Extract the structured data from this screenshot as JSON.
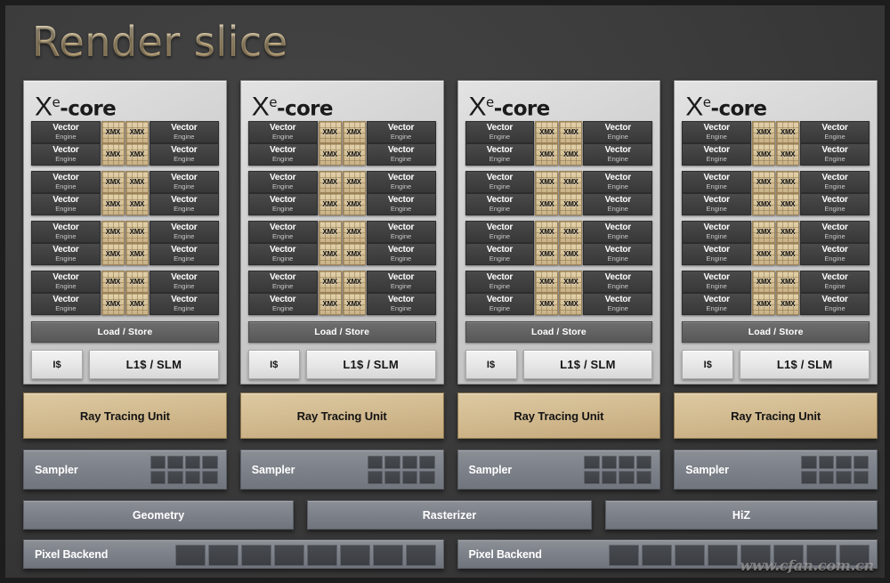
{
  "title": "Render slice",
  "core": {
    "title_x": "X",
    "title_sup": "e",
    "title_rest": "-core",
    "vector_label_1": "Vector",
    "vector_label_2": "Engine",
    "xmx_label": "XMX",
    "load_store_label": "Load / Store",
    "instruction_cache_label": "I$",
    "l1_slm_label": "L1$ / SLM",
    "groups_per_core": 4,
    "rows_per_group": 2,
    "count": 4
  },
  "ray_tracing": {
    "label": "Ray Tracing Unit",
    "count": 4,
    "color": "#d2ba90"
  },
  "sampler": {
    "label": "Sampler",
    "count": 4,
    "grid_cols": 4,
    "grid_rows": 2
  },
  "fixed_function": [
    {
      "label": "Geometry"
    },
    {
      "label": "Rasterizer"
    },
    {
      "label": "HiZ"
    }
  ],
  "pixel_backend": {
    "label": "Pixel Backend",
    "count": 2,
    "cells_per_block": 8
  },
  "watermark": "www.cfan.com.cn",
  "colors": {
    "background": "#3c3c3c",
    "panel": "#d4d4d4",
    "vector_engine": "#414141",
    "xmx": "#d5c096",
    "ray_tracing": "#d2ba90",
    "fixed_function": "#7e828a",
    "title_gold": "#e3cb9c"
  }
}
